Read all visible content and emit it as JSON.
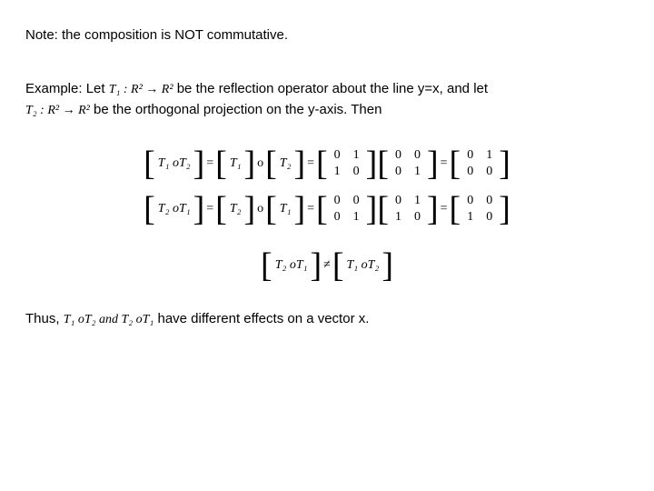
{
  "note": "Note: the composition is NOT commutative.",
  "example": {
    "lead": "Example: Let",
    "t1map": "T₁ : R² → R²",
    "mid": "be the reflection operator about the line y=x, and let",
    "t2map": "T₂ : R² → R²",
    "tail": "be the orthogonal projection on the y-axis. Then"
  },
  "eq1": {
    "lhs": "T₁ oT₂",
    "m1": "T₁",
    "m2": "T₂",
    "A": [
      [
        "0",
        "1"
      ],
      [
        "1",
        "0"
      ]
    ],
    "B": [
      [
        "0",
        "0"
      ],
      [
        "0",
        "1"
      ]
    ],
    "R": [
      [
        "0",
        "1"
      ],
      [
        "0",
        "0"
      ]
    ]
  },
  "eq2": {
    "lhs": "T₂ oT₁",
    "m1": "T₂",
    "m2": "T₁",
    "A": [
      [
        "0",
        "0"
      ],
      [
        "0",
        "1"
      ]
    ],
    "B": [
      [
        "0",
        "1"
      ],
      [
        "1",
        "0"
      ]
    ],
    "R": [
      [
        "0",
        "0"
      ],
      [
        "1",
        "0"
      ]
    ]
  },
  "neq": {
    "left": "T₂ oT₁",
    "right": "T₁ oT₂"
  },
  "thus": {
    "lead": "Thus,",
    "expr": "T₁ oT₂  and  T₂ oT₁",
    "tail": "have different effects on a vector x."
  }
}
